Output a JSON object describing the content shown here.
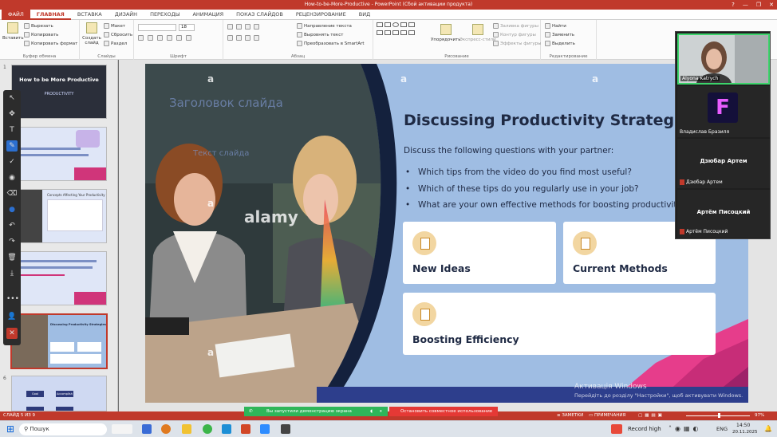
{
  "window": {
    "title": "How-to-be-More-Productive - PowerPoint (Сбой активации продукта)",
    "controls": [
      "?",
      "—",
      "❐",
      "✕"
    ]
  },
  "tabs": [
    "ФАЙЛ",
    "ГЛАВНАЯ",
    "ВСТАВКА",
    "ДИЗАЙН",
    "ПЕРЕХОДЫ",
    "АНИМАЦИЯ",
    "ПОКАЗ СЛАЙДОВ",
    "РЕЦЕНЗИРОВАНИЕ",
    "ВИД"
  ],
  "ribbon": {
    "clipboard": {
      "paste": "Вставить",
      "cut": "Вырезать",
      "copy": "Копировать",
      "format": "Копировать формат",
      "group": "Буфер обмена"
    },
    "slides": {
      "new_slide": "Создать слайд",
      "layout": "Макет",
      "reset": "Сбросить",
      "section": "Раздел",
      "group": "Слайды"
    },
    "font": {
      "size": "18",
      "group": "Шрифт"
    },
    "paragraph": {
      "text_direction": "Направление текста",
      "align_text": "Выровнять текст",
      "smartart": "Преобразовать в SmartArt",
      "group": "Абзац"
    },
    "drawing": {
      "arrange": "Упорядочить",
      "quick_styles": "Экспресс-стили",
      "fill": "Заливка фигуры",
      "outline": "Контур фигуры",
      "effects": "Эффекты фигуры",
      "group": "Рисование"
    },
    "editing": {
      "find": "Найти",
      "replace": "Заменить",
      "select": "Выделить",
      "group": "Редактирование"
    }
  },
  "thumbnails": [
    {
      "num": "1",
      "title": "How to be More Productive",
      "sub": "PRODUCTIVITY"
    },
    {
      "num": "",
      "text": ""
    },
    {
      "num": "",
      "title": "Concepts Affecting Your Productivity"
    },
    {
      "num": "",
      "text": ""
    },
    {
      "num": "5",
      "title": "Discussing Productivity Strategies"
    },
    {
      "num": "6",
      "buttons": [
        "Goal",
        "Accomplish"
      ]
    }
  ],
  "slide": {
    "title": "Discussing Productivity Strategies",
    "intro": "Discuss the following questions with your partner:",
    "bullets": [
      "Which tips from the video do you find most useful?",
      "Which of these tips do you regularly use in your job?",
      "What are your own effective methods for boosting productivity at w"
    ],
    "cards": [
      "New Ideas",
      "Current Methods",
      "Boosting Efficiency"
    ],
    "placeholder_title": "Заголовок слайда",
    "placeholder_text": "Текст слайда",
    "watermark": "alamy",
    "watermark_a": "a",
    "activation_title": "Активація Windows",
    "activation_sub": "Перейдіть до розділу \"Настройки\", щоб активувати Windows."
  },
  "video": {
    "participants": [
      {
        "name": "Alyona Katrych"
      },
      {
        "name": "Владислав Бразиля",
        "initial": "F"
      },
      {
        "name": "Дзюбар Артем",
        "label": "Дзюбар Артем"
      },
      {
        "name": "Артём Писоцкий",
        "label": "Артём Писоцкий"
      }
    ]
  },
  "statusbar": {
    "slide_info": "СЛАЙД 5 ИЗ 9",
    "notes": "ЗАМЕТКИ",
    "comments": "ПРИМЕЧАНИЯ",
    "zoom": "97%"
  },
  "sharebar": {
    "message": "Вы запустили демонстрацию экрана",
    "stop": "Остановить совместное использование"
  },
  "taskbar": {
    "search": "Пошук",
    "record": "Record high",
    "lang": "ENG",
    "time": "14:50",
    "date": "20.11.2025"
  },
  "colors": {
    "accent": "#c0392b",
    "slide_bg": "#9fbde3",
    "dark_text": "#1f2a44"
  }
}
